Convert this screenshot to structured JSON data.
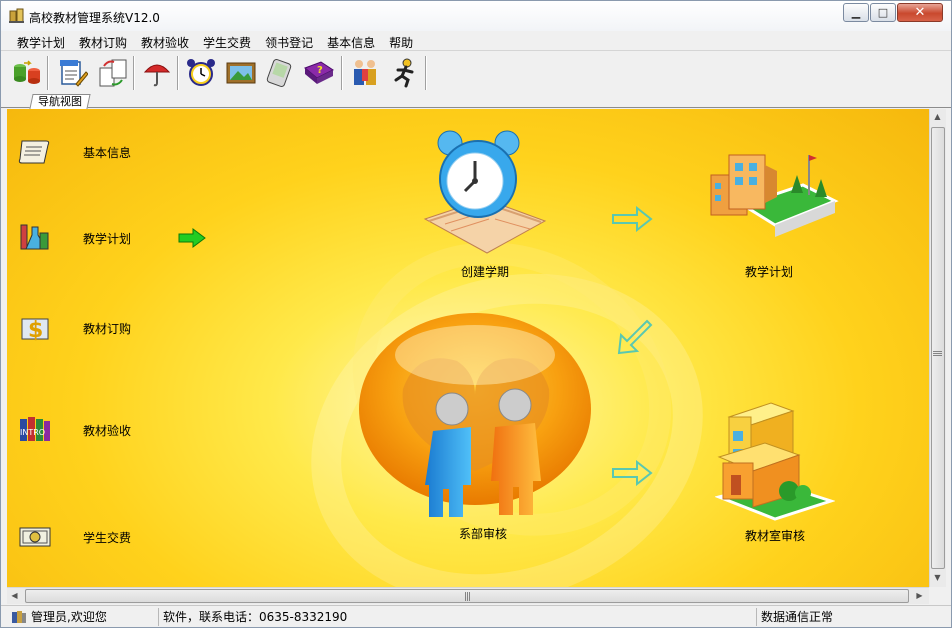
{
  "window": {
    "title": "高校教材管理系统V12.0",
    "buttons": {
      "minimize": "▁",
      "maximize": "□",
      "close": "✕"
    }
  },
  "menu": [
    "教学计划",
    "教材订购",
    "教材验收",
    "学生交费",
    "领书登记",
    "基本信息",
    "帮助"
  ],
  "toolbar": {
    "icons": [
      "database-transfer-icon",
      "document-pen-icon",
      "document-exchange-icon",
      "umbrella-icon",
      "alarm-clock-icon",
      "picture-frame-icon",
      "pda-icon",
      "help-book-icon",
      "users-icon",
      "runner-icon"
    ]
  },
  "tab": {
    "label": "导航视图"
  },
  "nav": {
    "items": [
      {
        "label": "基本信息",
        "icon": "scroll-icon"
      },
      {
        "label": "教学计划",
        "icon": "lab-flask-icon"
      },
      {
        "label": "教材订购",
        "icon": "dollar-icon"
      },
      {
        "label": "教材验收",
        "icon": "books-icon"
      },
      {
        "label": "学生交费",
        "icon": "money-icon"
      }
    ],
    "active_indicator": "green-arrow-icon"
  },
  "flow": {
    "nodes": [
      {
        "label": "创建学期",
        "icon": "alarm-clock-book-icon"
      },
      {
        "label": "教学计划",
        "icon": "school-building-icon"
      },
      {
        "label": "系部审核",
        "icon": "two-people-icon"
      },
      {
        "label": "教材室审核",
        "icon": "house-icon"
      }
    ]
  },
  "status": {
    "user": "管理员,欢迎您",
    "contact": "   软件，联系电话：0635-8332190",
    "connection": "数据通信正常"
  },
  "colors": {
    "main_bg": "#ffd21c",
    "flow_arrow": "#7fc8a0",
    "active_arrow": "#22cc22"
  }
}
